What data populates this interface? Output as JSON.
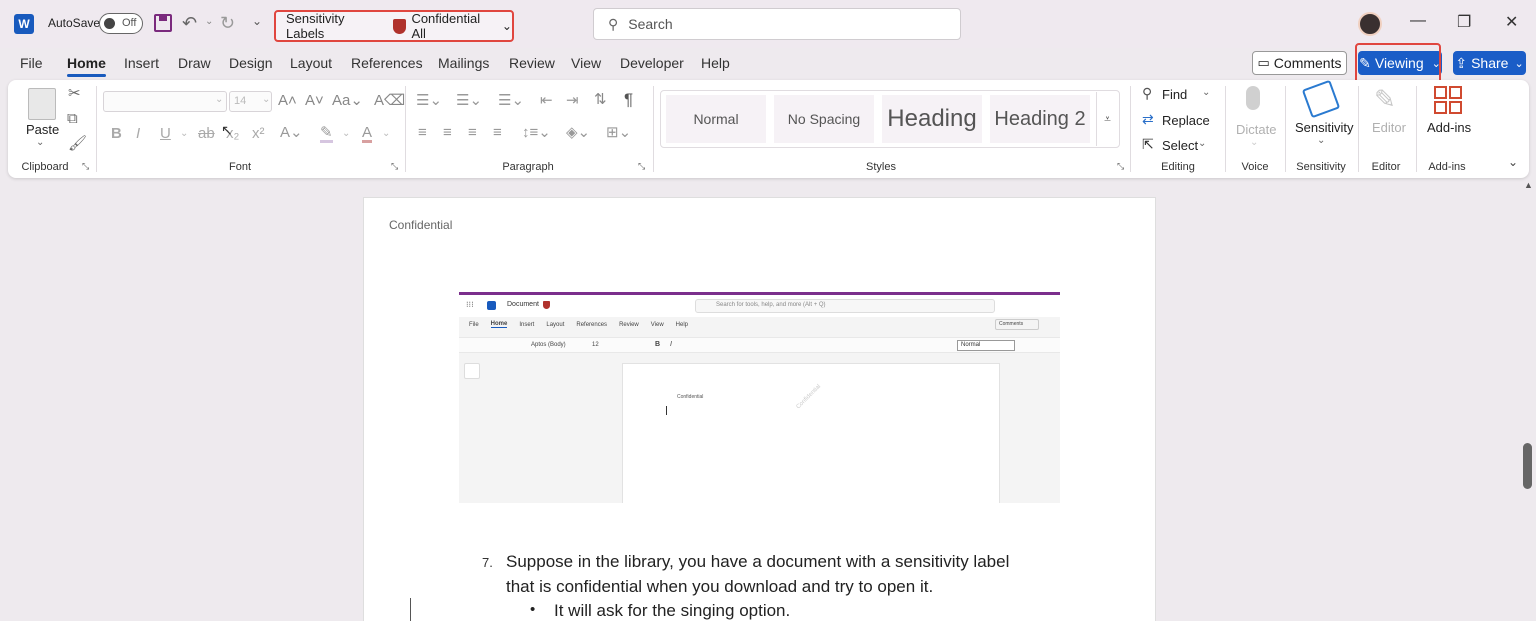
{
  "titlebar": {
    "autosave_label": "AutoSave",
    "autosave_state": "Off",
    "sensitivity_prefix": "Sensitivity Labels",
    "sensitivity_value": "Confidential All",
    "search_placeholder": "Search"
  },
  "menu": {
    "items": [
      "File",
      "Home",
      "Insert",
      "Draw",
      "Design",
      "Layout",
      "References",
      "Mailings",
      "Review",
      "View",
      "Developer",
      "Help"
    ],
    "active": "Home",
    "comments_label": "Comments",
    "viewing_label": "Viewing",
    "share_label": "Share"
  },
  "ribbon": {
    "clipboard": {
      "paste_label": "Paste",
      "group_label": "Clipboard"
    },
    "font": {
      "font_name": "",
      "font_size": "14",
      "group_label": "Font"
    },
    "paragraph": {
      "group_label": "Paragraph"
    },
    "styles": {
      "items": [
        "Normal",
        "No Spacing",
        "Heading",
        "Heading 2"
      ],
      "group_label": "Styles"
    },
    "editing": {
      "find_label": "Find",
      "replace_label": "Replace",
      "select_label": "Select",
      "group_label": "Editing"
    },
    "voice": {
      "dictate_label": "Dictate",
      "group_label": "Voice"
    },
    "sensitivity": {
      "label": "Sensitivity",
      "group_label": "Sensitivity"
    },
    "editor": {
      "label": "Editor",
      "group_label": "Editor"
    },
    "addins": {
      "label": "Add-ins",
      "group_label": "Add-ins"
    }
  },
  "document": {
    "header_text": "Confidential",
    "embedded": {
      "doc_title": "Document",
      "search_placeholder": "Search for tools, help, and more (Alt + Q)",
      "tabs": [
        "File",
        "Home",
        "Insert",
        "Layout",
        "References",
        "Review",
        "View",
        "Help"
      ],
      "comments_label": "Comments",
      "font_name": "Aptos (Body)",
      "font_size": "12",
      "style_value": "Normal",
      "page_header": "Confidential",
      "watermark": "Confidential"
    },
    "list_number": "7.",
    "para_line1": "Suppose in the library, you have a document with a sensitivity label",
    "para_line2": "that is confidential when you download and try to open it.",
    "bullet_text": "It will ask for the singing option."
  },
  "colors": {
    "accent": "#185abd",
    "highlight_box": "#e0463f",
    "label_shield": "#b0322c"
  }
}
